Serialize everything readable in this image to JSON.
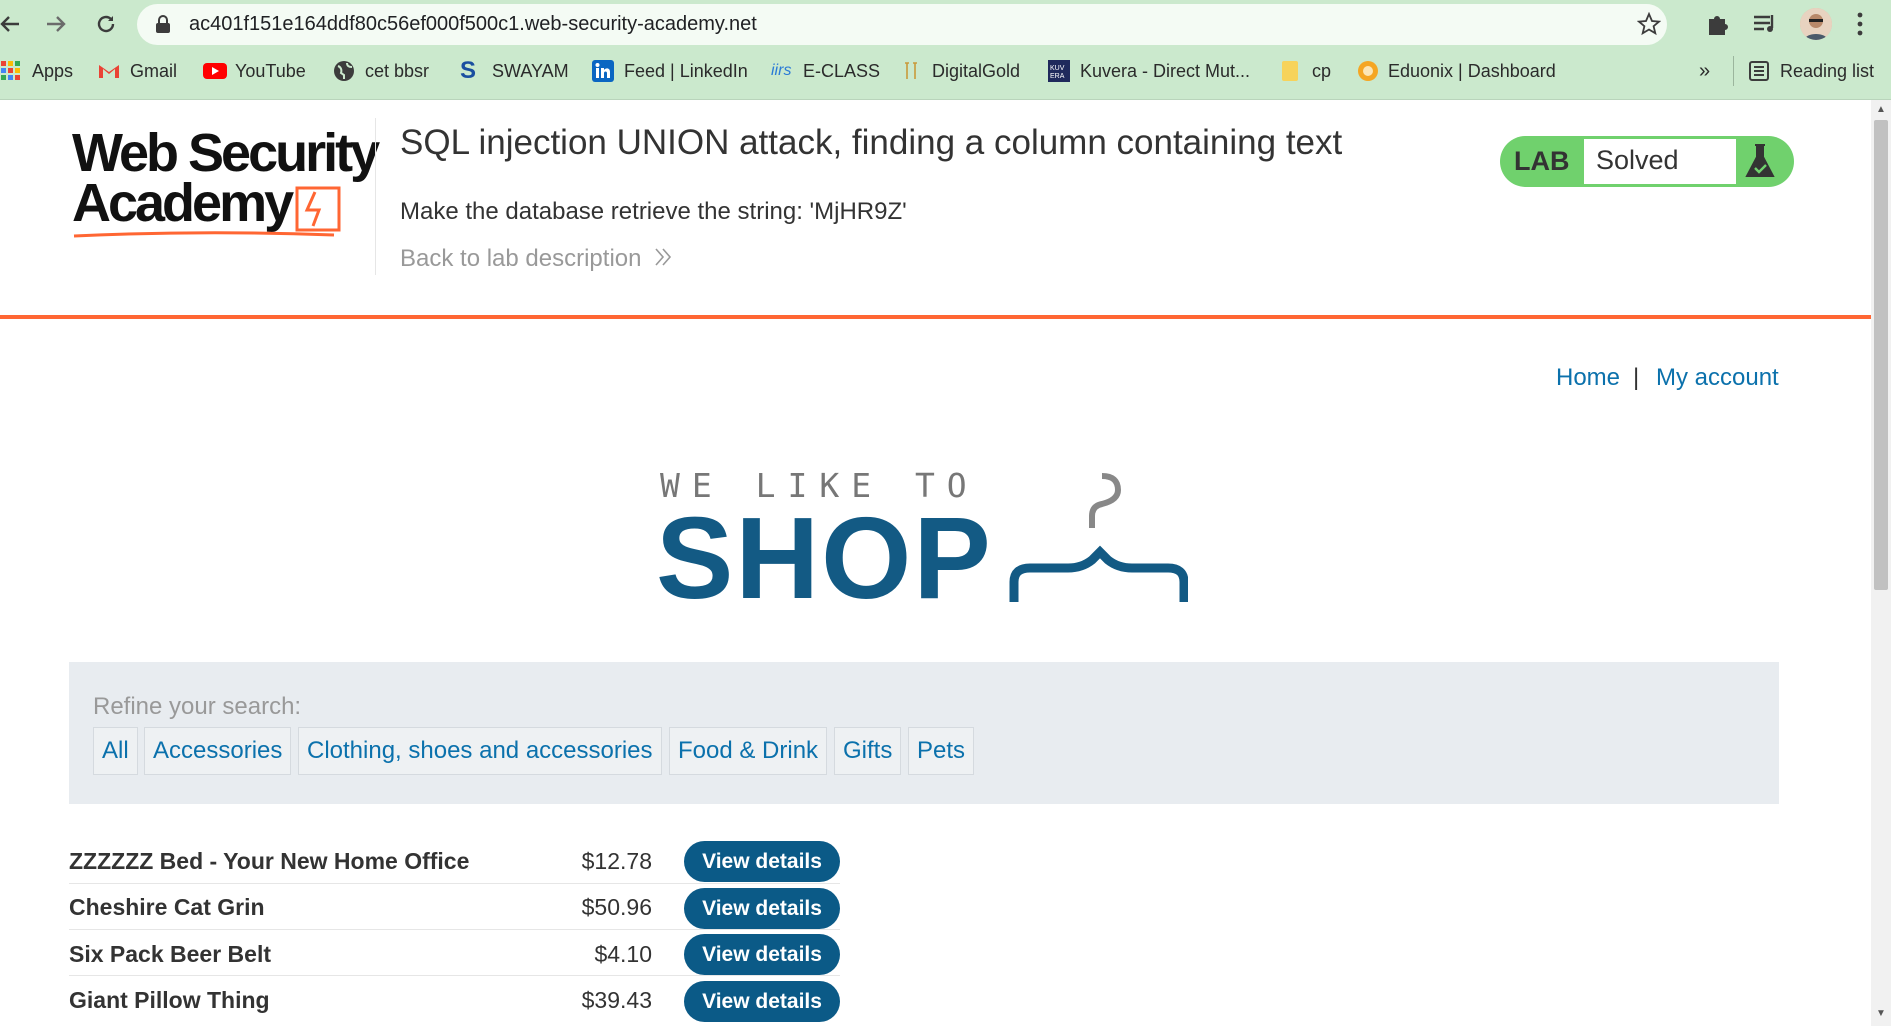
{
  "browser": {
    "url": "ac401f151e164ddf80c56ef000f500c1.web-security-academy.net",
    "bookmarks": [
      {
        "label": "Apps",
        "icon": "apps-grid-icon"
      },
      {
        "label": "Gmail",
        "icon": "gmail-icon"
      },
      {
        "label": "YouTube",
        "icon": "youtube-icon"
      },
      {
        "label": "cet bbsr",
        "icon": "globe-icon"
      },
      {
        "label": "SWAYAM",
        "icon": "swayam-icon"
      },
      {
        "label": "Feed | LinkedIn",
        "icon": "linkedin-icon"
      },
      {
        "label": "E-CLASS",
        "icon": "iirs-icon"
      },
      {
        "label": "DigitalGold",
        "icon": "digitalgold-icon"
      },
      {
        "label": "Kuvera - Direct Mut...",
        "icon": "kuvera-icon"
      },
      {
        "label": "cp",
        "icon": "folder-icon"
      },
      {
        "label": "Eduonix | Dashboard",
        "icon": "eduonix-icon"
      }
    ],
    "more": "»",
    "reading_list": "Reading list"
  },
  "lab": {
    "logo_line1": "Web Security",
    "logo_line2": "Academy",
    "title": "SQL injection UNION attack, finding a column containing text",
    "instruction": "Make the database retrieve the string: 'MjHR9Z'",
    "back_link": "Back to lab description",
    "badge_label": "LAB",
    "status": "Solved"
  },
  "shop": {
    "nav": {
      "home": "Home",
      "separator": "|",
      "account": "My account"
    },
    "logo_top": "WE LIKE TO",
    "logo_main": "SHOP",
    "refine_label": "Refine your search:",
    "categories": [
      "All",
      "Accessories",
      "Clothing, shoes and accessories",
      "Food & Drink",
      "Gifts",
      "Pets"
    ],
    "products": [
      {
        "name": "ZZZZZZ Bed - Your New Home Office",
        "price": "$12.78",
        "button": "View details"
      },
      {
        "name": "Cheshire Cat Grin",
        "price": "$50.96",
        "button": "View details"
      },
      {
        "name": "Six Pack Beer Belt",
        "price": "$4.10",
        "button": "View details"
      },
      {
        "name": "Giant Pillow Thing",
        "price": "$39.43",
        "button": "View details"
      }
    ]
  },
  "colors": {
    "chrome_bg": "#cbe9cd",
    "accent_orange": "#ff6633",
    "link_blue": "#0b71ac",
    "button_blue": "#0b5a87",
    "badge_green": "#70d16d"
  }
}
